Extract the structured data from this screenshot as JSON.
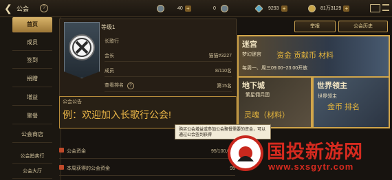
{
  "topbar": {
    "back_label": "公会",
    "resources": [
      {
        "icon": "energy-icon",
        "value": "40"
      },
      {
        "icon": "coin-icon",
        "value": "0"
      },
      {
        "icon": "gem-icon",
        "value": "9293"
      },
      {
        "icon": "gold-icon",
        "value": "81万3129"
      }
    ]
  },
  "sidebar": {
    "items": [
      {
        "label": "首页",
        "active": true
      },
      {
        "label": "成员"
      },
      {
        "label": "签到"
      },
      {
        "label": "捐赠"
      },
      {
        "label": "增益"
      },
      {
        "label": "聚餐"
      },
      {
        "label": "公会商店"
      },
      {
        "label": "公会拍卖行"
      },
      {
        "label": "公会大厅"
      }
    ]
  },
  "guild": {
    "level": "等级1",
    "name": "长歌行",
    "rows": [
      {
        "label": "会长",
        "value": "猫猫#3227"
      },
      {
        "label": "成员",
        "value": "8/110名"
      },
      {
        "label": "查看排名",
        "value": "第15名"
      }
    ]
  },
  "notice": {
    "title": "公会公告",
    "text": "例：欢迎加入长歌行公会!"
  },
  "bottom_rows": [
    {
      "label": "公会资金",
      "value": "95/100,000"
    },
    {
      "label": "本周获得的公会资金",
      "value": "95"
    }
  ],
  "buttons": {
    "report": "举报",
    "history": "公会历史"
  },
  "panels": {
    "maze": {
      "title": "迷宫",
      "subtitle": "梦幻迷宫",
      "tags": "资金  贡献币  材料",
      "schedule": "每周一、周三09:00~23:00开放"
    },
    "dungeon": {
      "title": "地下城",
      "subtitle": "繁星佣兵团",
      "tags": "灵魂（材料）"
    },
    "world_boss": {
      "title": "世界领主",
      "subtitle": "世界领主",
      "tags": "金币  排名"
    }
  },
  "tooltip": {
    "text": "购买公会增益或参加公会聚餐需要的资金，可以通过公会签到获得"
  },
  "watermark": {
    "text": "国投新游网",
    "url": "www.sxsgytr.com"
  }
}
